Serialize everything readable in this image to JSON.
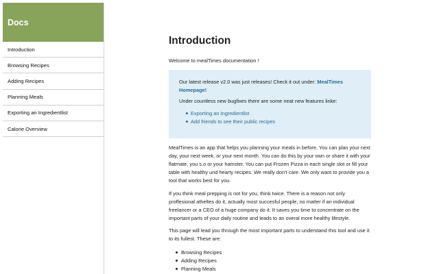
{
  "sidebar": {
    "title": "Docs",
    "items": [
      {
        "label": "Introduction"
      },
      {
        "label": "Browsing Recipes"
      },
      {
        "label": "Adding Recipes"
      },
      {
        "label": "Planning Meals"
      },
      {
        "label": "Exporting an Ingredientlist"
      },
      {
        "label": "Calorie Overview"
      }
    ]
  },
  "main": {
    "title": "Introduction",
    "welcome": "Welcome to mealTimes documentation !",
    "callout": {
      "release_text": "Our latest release v2.0 was just releases! Check it out under: ",
      "homepage_link": "MealTimes Homepage!",
      "features_intro": "Under countless new bugfixes there are some neat new features linke:",
      "features": [
        "Exporting an Ingredientlist",
        "Add friends to see their public recipes"
      ]
    },
    "paragraphs": [
      "MealTimes is an app that helps you planning your meals in before. You can plan your next day, your next week, or your next month. You can do this by your own or share it with your flatmate, you s.o or your hamster. You can put Frozen Pizza in each single slot or fill your table with healthy und hearty recipes. We really don't care. We only want to provide you a tool that works best for you.",
      "If you think meal prepping is not for you, think twice. There is a reason not only proffesional atheltes do it, actually most succesful people, no matter if an individual freelancer or a CEO of a huge company do it. It saves you time to concentrate on the important parts of your daily routine and leads to an overal more healthy lifestyle.",
      "This page will lead you through the most important parts to understand this tool and use it to its fullest. These are:"
    ],
    "parts": [
      "Browsing Recipes",
      "Adding Recipes",
      "Planning Meals"
    ]
  },
  "colors": {
    "sidebar_header": "#88a35a",
    "callout_background": "#dfeef7",
    "link": "#2f6a8d"
  }
}
